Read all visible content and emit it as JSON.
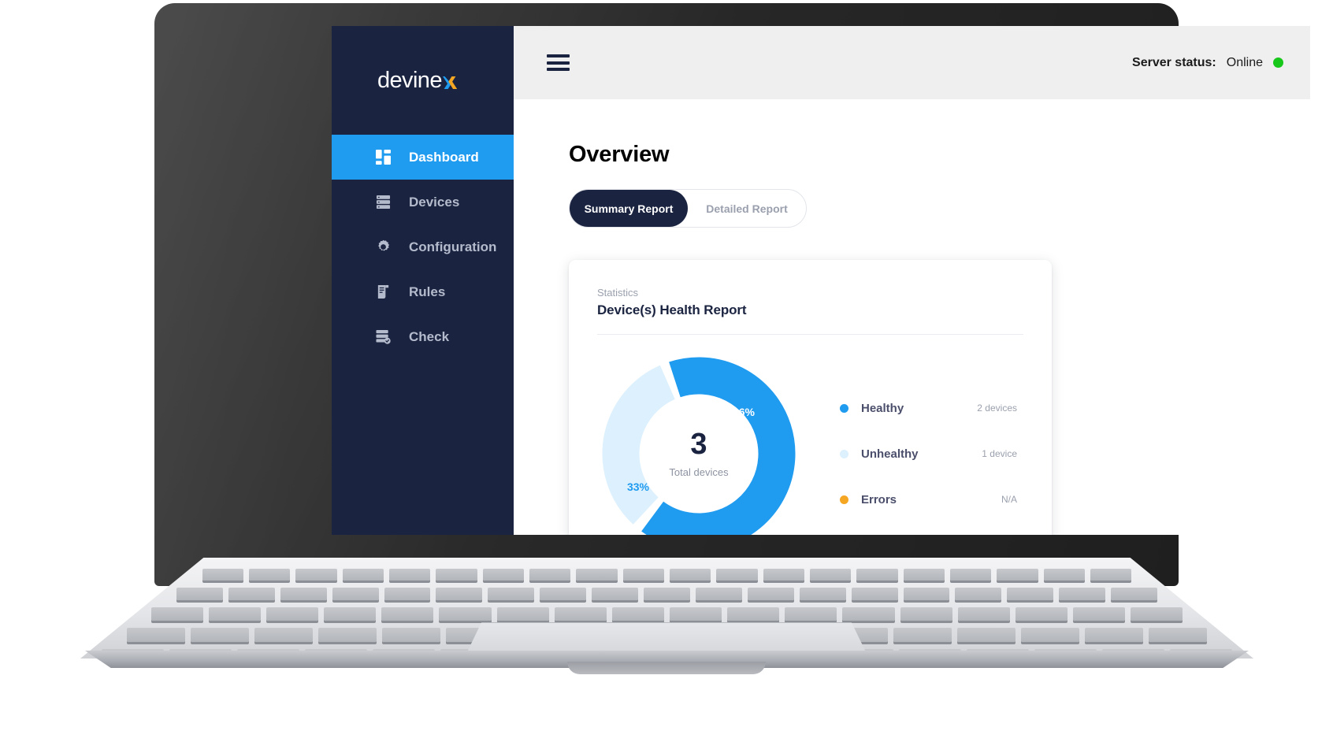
{
  "brand": {
    "text_main": "devine",
    "text_accent": "x"
  },
  "sidebar": {
    "items": [
      {
        "label": "Dashboard",
        "icon": "grid-icon",
        "active": true
      },
      {
        "label": "Devices",
        "icon": "server-icon",
        "active": false
      },
      {
        "label": "Configuration",
        "icon": "gear-icon",
        "active": false
      },
      {
        "label": "Rules",
        "icon": "scroll-icon",
        "active": false
      },
      {
        "label": "Check",
        "icon": "server-check-icon",
        "active": false
      }
    ]
  },
  "topbar": {
    "menu_icon": "hamburger-icon",
    "status_label": "Server status:",
    "status_value": "Online",
    "status_color": "#17c81b"
  },
  "main": {
    "page_title": "Overview",
    "tabs": [
      {
        "label": "Summary Report",
        "active": true
      },
      {
        "label": "Detailed Report",
        "active": false
      }
    ]
  },
  "card": {
    "eyebrow": "Statistics",
    "title": "Device(s) Health Report",
    "center_value": "3",
    "center_label": "Total devices"
  },
  "chart_data": {
    "type": "pie",
    "title": "Device(s) Health Report",
    "subtitle": "Statistics",
    "donut": true,
    "total": 3,
    "total_label": "Total devices",
    "categories": [
      "Healthy",
      "Unhealthy",
      "Errors"
    ],
    "values": [
      2,
      1,
      0
    ],
    "percent_labels": [
      "66%",
      "33%",
      ""
    ],
    "percents": [
      66,
      33,
      0
    ],
    "value_labels": [
      "2 devices",
      "1 device",
      "N/A"
    ],
    "colors": [
      "#1f9bf0",
      "#dcf0fd",
      "#f5a623"
    ],
    "label_text_colors": [
      "#ffffff",
      "#1f9bf0",
      ""
    ],
    "legend_position": "right",
    "legend": [
      {
        "name": "Healthy",
        "value": "2 devices",
        "color": "#1f9bf0"
      },
      {
        "name": "Unhealthy",
        "value": "1 device",
        "color": "#dcf0fd"
      },
      {
        "name": "Errors",
        "value": "N/A",
        "color": "#f5a623"
      }
    ]
  }
}
